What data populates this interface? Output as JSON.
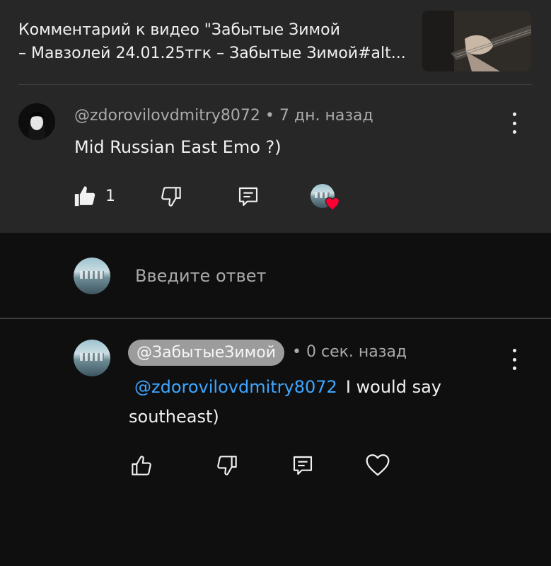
{
  "header": {
    "title_line1": "Комментарий к видео \"Забытые Зимой",
    "title_line2": "– Мавзолей 24.01.25тгк – Забытые Зимой#alt..."
  },
  "comment": {
    "author": "@zdorovilovdmitry8072",
    "separator": "•",
    "time": "7 дн. назад",
    "text": "Mid Russian East Emo ?)",
    "like_count": "1"
  },
  "reply_input": {
    "placeholder": "Введите ответ"
  },
  "reply": {
    "author": "@ЗабытыеЗимой",
    "separator": "•",
    "time": "0 сек. назад",
    "mention": "@zdorovilovdmitry8072",
    "text_line1": "I would say",
    "text_line2": "southeast)"
  },
  "colors": {
    "link": "#3ea6ff",
    "heart": "#ff0033",
    "panel": "#272727",
    "background": "#0f0f0f"
  },
  "icons": [
    "thumbs-up-filled-icon",
    "thumbs-down-icon",
    "reply-icon",
    "creator-heart-icon",
    "thumbs-up-icon",
    "heart-outline-icon",
    "more-vert-icon"
  ]
}
